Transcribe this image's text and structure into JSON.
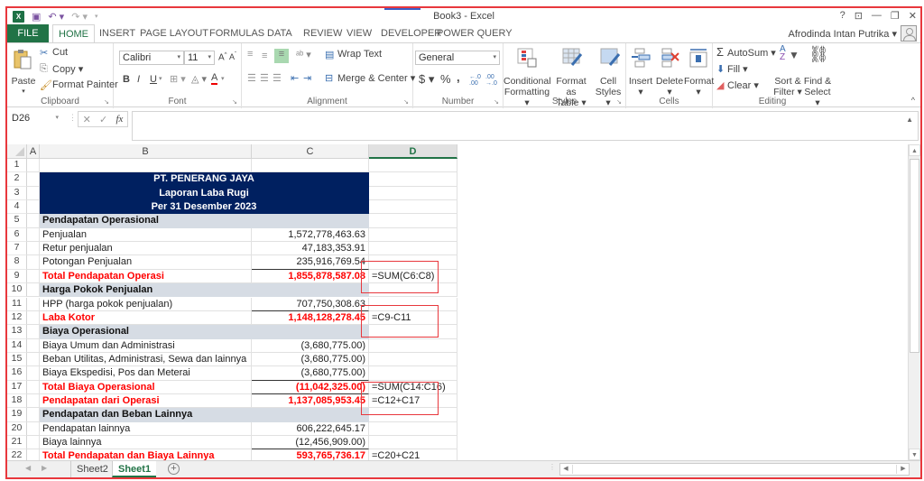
{
  "window": {
    "title": "Book3 - Excel",
    "help": "?",
    "ribbon_display": "⊡",
    "minimize": "—",
    "restore": "❐",
    "close": "✕",
    "user": "Afrodinda Intan Putrika ▾"
  },
  "qat": {
    "logo": "X",
    "save": "💾",
    "undo": "↶ ▾",
    "redo": "↷ ▾",
    "customize": "▾"
  },
  "tabs": [
    {
      "label": "FILE"
    },
    {
      "label": "HOME"
    },
    {
      "label": "INSERT"
    },
    {
      "label": "PAGE LAYOUT"
    },
    {
      "label": "FORMULAS"
    },
    {
      "label": "DATA"
    },
    {
      "label": "REVIEW"
    },
    {
      "label": "VIEW"
    },
    {
      "label": "DEVELOPER"
    },
    {
      "label": "POWER QUERY"
    }
  ],
  "ribbon": {
    "clipboard": {
      "label": "Clipboard",
      "paste": "Paste",
      "cut": "Cut",
      "copy": "Copy ▾",
      "format_painter": "Format Painter"
    },
    "font": {
      "label": "Font",
      "font_name": "Calibri",
      "font_size": "11",
      "bold": "B",
      "italic": "I",
      "underline": "U"
    },
    "alignment": {
      "label": "Alignment",
      "wrap_text": "Wrap Text",
      "merge_center": "Merge & Center ▾"
    },
    "number": {
      "label": "Number",
      "format": "General",
      "currency": "$ ▾",
      "percent": "%",
      "comma": ",",
      "inc_dec": "+.0 .00",
      "dec_dec": ".00 →.0"
    },
    "styles": {
      "label": "Styles",
      "conditional_1": "Conditional",
      "conditional_2": "Formatting ▾",
      "format_table_1": "Format as",
      "format_table_2": "Table ▾",
      "cell_styles_1": "Cell",
      "cell_styles_2": "Styles ▾"
    },
    "cells": {
      "label": "Cells",
      "insert": "Insert",
      "delete": "Delete",
      "format": "Format"
    },
    "editing": {
      "label": "Editing",
      "autosum": "AutoSum ▾",
      "fill": "Fill ▾",
      "clear": "Clear ▾",
      "sort_1": "Sort &",
      "sort_2": "Filter ▾",
      "find_1": "Find &",
      "find_2": "Select ▾"
    }
  },
  "formula_bar": {
    "name_box": "D26",
    "cancel": "✕",
    "enter": "✓",
    "fx": "fx",
    "value": ""
  },
  "columns": [
    "A",
    "B",
    "C",
    "D"
  ],
  "rows": [
    {
      "n": "1",
      "style": "blank",
      "b": "",
      "c": "",
      "d": ""
    },
    {
      "n": "2",
      "style": "title",
      "b": "PT. PENERANG JAYA",
      "c": "",
      "d": ""
    },
    {
      "n": "3",
      "style": "title",
      "b": "Laporan Laba Rugi",
      "c": "",
      "d": ""
    },
    {
      "n": "4",
      "style": "title",
      "b": "Per 31 Desember 2023",
      "c": "",
      "d": ""
    },
    {
      "n": "5",
      "style": "section",
      "b": "Pendapatan Operasional",
      "c": "",
      "d": ""
    },
    {
      "n": "6",
      "style": "item",
      "b": "Penjualan",
      "c": "1,572,778,463.63",
      "d": ""
    },
    {
      "n": "7",
      "style": "item",
      "b": "Retur penjualan",
      "c": "47,183,353.91",
      "d": ""
    },
    {
      "n": "8",
      "style": "item",
      "b": "Potongan Penjualan",
      "c": "235,916,769.54",
      "d": ""
    },
    {
      "n": "9",
      "style": "total",
      "b": "Total Pendapatan Operasi",
      "c": "1,855,878,587.08",
      "d": "=SUM(C6:C8)"
    },
    {
      "n": "10",
      "style": "section",
      "b": "Harga Pokok Penjualan",
      "c": "",
      "d": ""
    },
    {
      "n": "11",
      "style": "item",
      "b": "HPP (harga pokok penjualan)",
      "c": "707,750,308.63",
      "d": ""
    },
    {
      "n": "12",
      "style": "total",
      "b": "Laba Kotor",
      "c": "1,148,128,278.45",
      "d": "=C9-C11"
    },
    {
      "n": "13",
      "style": "section",
      "b": "Biaya Operasional",
      "c": "",
      "d": ""
    },
    {
      "n": "14",
      "style": "item",
      "b": "Biaya Umum dan Administrasi",
      "c": "(3,680,775.00)",
      "d": ""
    },
    {
      "n": "15",
      "style": "item",
      "b": "Beban Utilitas, Administrasi, Sewa dan lainnya",
      "c": "(3,680,775.00)",
      "d": ""
    },
    {
      "n": "16",
      "style": "item",
      "b": "Biaya Ekspedisi, Pos dan Meterai",
      "c": "(3,680,775.00)",
      "d": ""
    },
    {
      "n": "17",
      "style": "total",
      "b": "Total Biaya Operasional",
      "c": "(11,042,325.00)",
      "d": "=SUM(C14:C16)"
    },
    {
      "n": "18",
      "style": "total",
      "b": "Pendapatan dari Operasi",
      "c": "1,137,085,953.45",
      "d": "=C12+C17"
    },
    {
      "n": "19",
      "style": "section",
      "b": "Pendapatan dan Beban Lainnya",
      "c": "",
      "d": ""
    },
    {
      "n": "20",
      "style": "item",
      "b": "Pendapatan lainnya",
      "c": "606,222,645.17",
      "d": ""
    },
    {
      "n": "21",
      "style": "item",
      "b": "Biaya lainnya",
      "c": "(12,456,909.00)",
      "d": ""
    },
    {
      "n": "22",
      "style": "total",
      "b": "Total Pendapatan dan Biaya Lainnya",
      "c": "593,765,736.17",
      "d": "=C20+C21"
    }
  ],
  "sheets": [
    {
      "label": "Sheet2",
      "active": false
    },
    {
      "label": "Sheet1",
      "active": true
    }
  ],
  "add_sheet": "+",
  "colors": {
    "excel_green": "#217346",
    "title_fill": "#002060",
    "section_fill": "#d6dce4",
    "total_text": "#ff0000",
    "annotation": "#e8383d"
  }
}
